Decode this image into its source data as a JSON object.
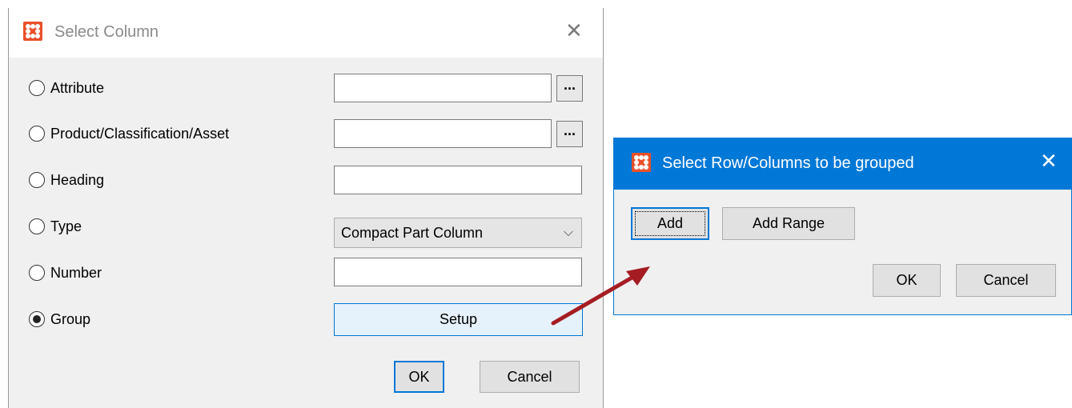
{
  "dialog_main": {
    "title": "Select Column",
    "options": [
      {
        "label": "Attribute",
        "checked": false
      },
      {
        "label": "Product/Classification/Asset",
        "checked": false
      },
      {
        "label": "Heading",
        "checked": false
      },
      {
        "label": "Type",
        "checked": false
      },
      {
        "label": "Number",
        "checked": false
      },
      {
        "label": "Group",
        "checked": true
      }
    ],
    "browse_label": "...",
    "type_value": "Compact Part Column",
    "setup_label": "Setup",
    "ok_label": "OK",
    "cancel_label": "Cancel"
  },
  "dialog_group": {
    "title": "Select Row/Columns to be grouped",
    "add_label": "Add",
    "add_range_label": "Add Range",
    "ok_label": "OK",
    "cancel_label": "Cancel"
  },
  "colors": {
    "accent": "#0078d7",
    "app_icon": "#e8502a",
    "arrow": "#a51c23"
  },
  "icons": [
    "app-icon",
    "close-icon",
    "chevron-down-icon",
    "arrow-icon"
  ]
}
